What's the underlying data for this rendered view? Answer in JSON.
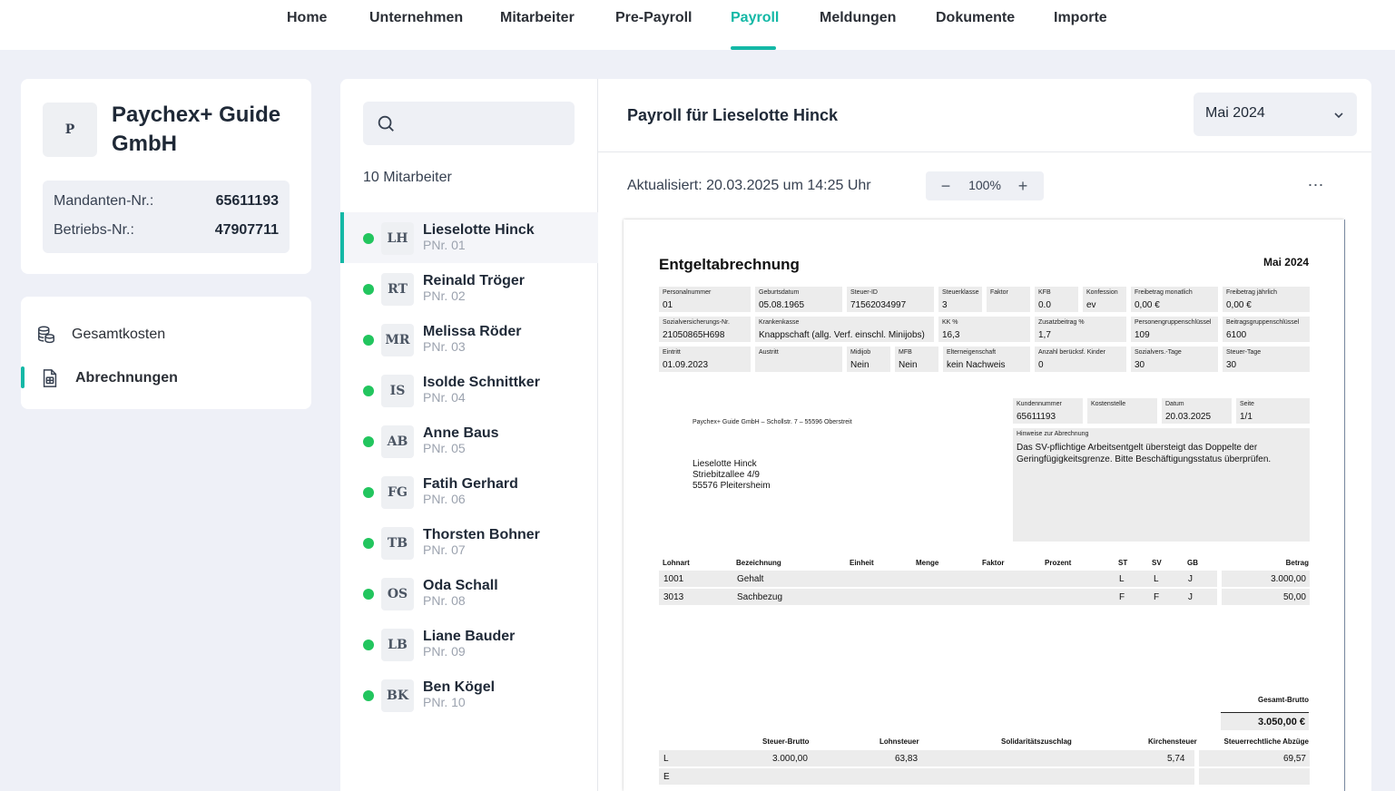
{
  "nav": {
    "items": [
      "Home",
      "Unternehmen",
      "Mitarbeiter",
      "Pre-Payroll",
      "Payroll",
      "Meldungen",
      "Dokumente",
      "Importe"
    ],
    "active": "Payroll"
  },
  "company": {
    "avatar": "P",
    "name": "Paychex+ Guide GmbH",
    "mandant_label": "Mandanten-Nr.:",
    "mandant_value": "65611193",
    "betrieb_label": "Betriebs-Nr.:",
    "betrieb_value": "47907711"
  },
  "side_nav": {
    "items": [
      {
        "label": "Gesamtkosten",
        "icon": "coins-icon"
      },
      {
        "label": "Abrechnungen",
        "icon": "document-icon",
        "active": true
      }
    ]
  },
  "employees": {
    "search_placeholder": "",
    "count_label": "10 Mitarbeiter",
    "list": [
      {
        "initials": "LH",
        "name": "Lieselotte Hinck",
        "pnr": "PNr. 01",
        "active": true
      },
      {
        "initials": "RT",
        "name": "Reinald Tröger",
        "pnr": "PNr. 02"
      },
      {
        "initials": "MR",
        "name": "Melissa Röder",
        "pnr": "PNr. 03"
      },
      {
        "initials": "IS",
        "name": "Isolde Schnittker",
        "pnr": "PNr. 04"
      },
      {
        "initials": "AB",
        "name": "Anne Baus",
        "pnr": "PNr. 05"
      },
      {
        "initials": "FG",
        "name": "Fatih Gerhard",
        "pnr": "PNr. 06"
      },
      {
        "initials": "TB",
        "name": "Thorsten Bohner",
        "pnr": "PNr. 07"
      },
      {
        "initials": "OS",
        "name": "Oda Schall",
        "pnr": "PNr. 08"
      },
      {
        "initials": "LB",
        "name": "Liane Bauder",
        "pnr": "PNr. 09"
      },
      {
        "initials": "BK",
        "name": "Ben Kögel",
        "pnr": "PNr. 10"
      }
    ]
  },
  "main": {
    "title": "Payroll für Lieselotte Hinck",
    "month": "Mai 2024",
    "updated": "Aktualisiert: 20.03.2025 um 14:25 Uhr",
    "zoom": "100%",
    "zoom_minus": "−",
    "zoom_plus": "+",
    "more": "⋯"
  },
  "doc": {
    "title": "Entgeltabrechnung",
    "month": "Mai 2024",
    "row1": [
      {
        "l": "Personalnummer",
        "v": "01"
      },
      {
        "l": "Geburtsdatum",
        "v": "05.08.1965"
      },
      {
        "l": "Steuer-ID",
        "v": "71562034997"
      },
      {
        "l": "Steuerklasse",
        "v": "3"
      },
      {
        "l": "Faktor",
        "v": ""
      },
      {
        "l": "KFB",
        "v": "0.0"
      },
      {
        "l": "Konfession",
        "v": "ev"
      },
      {
        "l": "Freibetrag monatlich",
        "v": "0,00 €"
      },
      {
        "l": "Freibetrag jährlich",
        "v": "0,00 €"
      }
    ],
    "row2": [
      {
        "l": "Sozialversicherungs-Nr.",
        "v": "21050865H698"
      },
      {
        "l": "Krankenkasse",
        "v": "Knappschaft (allg. Verf. einschl. Minijobs)"
      },
      {
        "l": "KK %",
        "v": "16,3"
      },
      {
        "l": "Zusatzbeitrag %",
        "v": "1,7"
      },
      {
        "l": "Personengruppenschlüssel",
        "v": "109"
      },
      {
        "l": "Beitragsgruppenschlüssel",
        "v": "6100"
      }
    ],
    "row3": [
      {
        "l": "Eintritt",
        "v": "01.09.2023"
      },
      {
        "l": "Austritt",
        "v": ""
      },
      {
        "l": "Midijob",
        "v": "Nein"
      },
      {
        "l": "MFB",
        "v": "Nein"
      },
      {
        "l": "Elterneigenschaft",
        "v": "kein Nachweis"
      },
      {
        "l": "Anzahl berücksf. Kinder",
        "v": "0"
      },
      {
        "l": "Sozialvers.-Tage",
        "v": "30"
      },
      {
        "l": "Steuer-Tage",
        "v": "30"
      }
    ],
    "row4": [
      {
        "l": "Kundennummer",
        "v": "65611193"
      },
      {
        "l": "Kostenstelle",
        "v": ""
      },
      {
        "l": "Datum",
        "v": "20.03.2025"
      },
      {
        "l": "Seite",
        "v": "1/1"
      }
    ],
    "sender": "Paychex+ Guide GmbH – Schollstr. 7 – 55596 Oberstreit",
    "address": [
      "Lieselotte Hinck",
      "Striebitzallee 4/9",
      "55576 Pleitersheim"
    ],
    "note_label": "Hinweise zur Abrechnung",
    "note_text": "Das SV-pflichtige Arbeitsentgelt übersteigt das Doppelte der Geringfügigkeitsgrenze. Bitte Beschäftigungsstatus überprüfen.",
    "table_headers": [
      "Lohnart",
      "Bezeichnung",
      "Einheit",
      "Menge",
      "Faktor",
      "Prozent",
      "ST",
      "SV",
      "GB",
      "Betrag"
    ],
    "table_rows": [
      {
        "lohnart": "1001",
        "bez": "Gehalt",
        "st": "L",
        "sv": "L",
        "gb": "J",
        "betrag": "3.000,00"
      },
      {
        "lohnart": "3013",
        "bez": "Sachbezug",
        "st": "F",
        "sv": "F",
        "gb": "J",
        "betrag": "50,00"
      }
    ],
    "gesamt_label": "Gesamt-Brutto",
    "gesamt_value": "3.050,00 €",
    "tax_headers": [
      "Steuer-Brutto",
      "Lohnsteuer",
      "Solidaritätszuschlag",
      "Kirchensteuer",
      "Steuerrechtliche Abzüge"
    ],
    "tax_rows": [
      {
        "k": "L",
        "brutto": "3.000,00",
        "lst": "63,83",
        "soli": "",
        "kist": "5,74",
        "sum": "69,57"
      },
      {
        "k": "E",
        "brutto": "",
        "lst": "",
        "soli": "",
        "kist": "",
        "sum": ""
      }
    ]
  },
  "colors": {
    "accent": "#14b8a6",
    "status_green": "#22c55e",
    "page_bg": "#eef0f7"
  }
}
